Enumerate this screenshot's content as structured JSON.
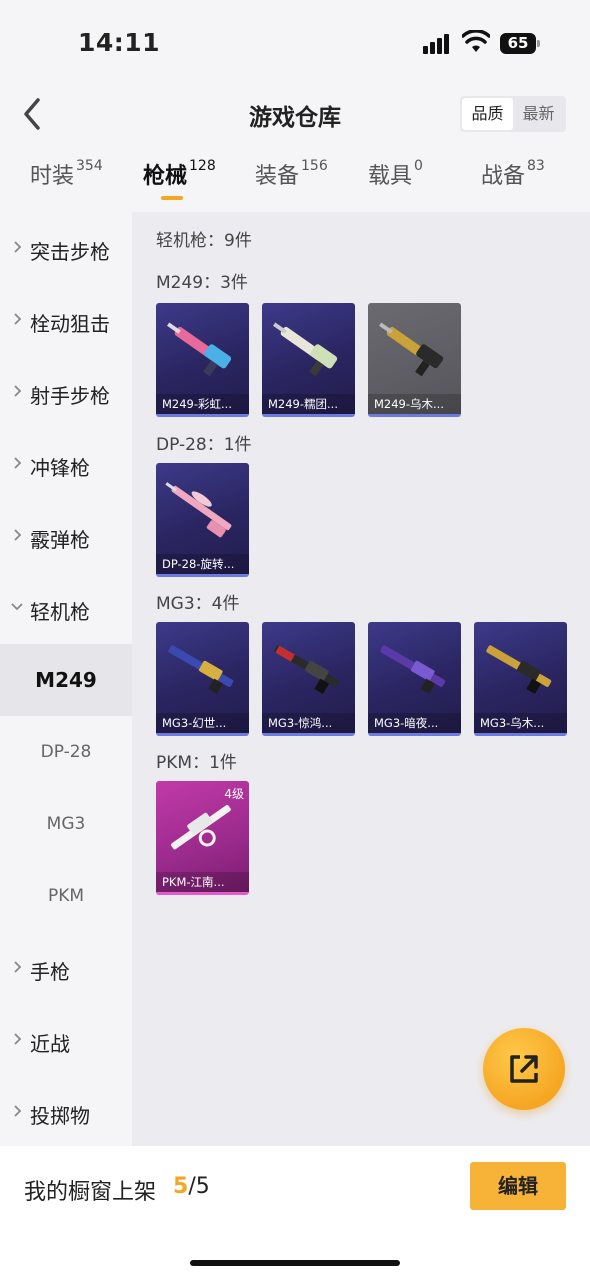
{
  "status": {
    "time": "14:11",
    "battery": "65"
  },
  "nav": {
    "title": "游戏仓库",
    "sort": [
      "品质",
      "最新"
    ]
  },
  "tabs": [
    {
      "label": "时装",
      "count": "354"
    },
    {
      "label": "枪械",
      "count": "128"
    },
    {
      "label": "装备",
      "count": "156"
    },
    {
      "label": "载具",
      "count": "0"
    },
    {
      "label": "战备",
      "count": "83"
    }
  ],
  "sidebar": [
    {
      "label": "突击步枪",
      "type": "category",
      "expanded": false
    },
    {
      "label": "栓动狙击",
      "type": "category",
      "expanded": false
    },
    {
      "label": "射手步枪",
      "type": "category",
      "expanded": false
    },
    {
      "label": "冲锋枪",
      "type": "category",
      "expanded": false
    },
    {
      "label": "霰弹枪",
      "type": "category",
      "expanded": false
    },
    {
      "label": "轻机枪",
      "type": "category",
      "expanded": true
    },
    {
      "label": "M249",
      "type": "sub",
      "active": true
    },
    {
      "label": "DP-28",
      "type": "sub"
    },
    {
      "label": "MG3",
      "type": "sub"
    },
    {
      "label": "PKM",
      "type": "sub"
    },
    {
      "label": "手枪",
      "type": "category",
      "expanded": false
    },
    {
      "label": "近战",
      "type": "category",
      "expanded": false
    },
    {
      "label": "投掷物",
      "type": "category",
      "expanded": false
    }
  ],
  "content": {
    "summary": "轻机枪：9件",
    "groups": [
      {
        "title": "M249：3件",
        "items": [
          {
            "caption": "M249-彩虹...",
            "rarity": "purple",
            "gun": "pink-blue"
          },
          {
            "caption": "M249-糯团...",
            "rarity": "purple",
            "gun": "white"
          },
          {
            "caption": "M249-乌木...",
            "rarity": "gray",
            "gun": "gold"
          }
        ]
      },
      {
        "title": "DP-28：1件",
        "items": [
          {
            "caption": "DP-28-旋转...",
            "rarity": "purple",
            "gun": "pink"
          }
        ]
      },
      {
        "title": "MG3：4件",
        "items": [
          {
            "caption": "MG3-幻世...",
            "rarity": "purple",
            "gun": "blue-gold"
          },
          {
            "caption": "MG3-惊鸿...",
            "rarity": "purple",
            "gun": "red-dark"
          },
          {
            "caption": "MG3-暗夜...",
            "rarity": "purple",
            "gun": "purple"
          },
          {
            "caption": "MG3-乌木...",
            "rarity": "purple",
            "gun": "gold"
          }
        ]
      },
      {
        "title": "PKM：1件",
        "items": [
          {
            "caption": "PKM-江南...",
            "rarity": "pink",
            "gun": "white",
            "level": "4级"
          }
        ]
      }
    ]
  },
  "bottom": {
    "window_label": "我的橱窗上架",
    "current": "5",
    "total": "/5",
    "edit_label": "编辑"
  },
  "colors": {
    "accent": "#f5a623",
    "purple_card": "#2a2560",
    "pink_card": "#9a2a8c"
  }
}
